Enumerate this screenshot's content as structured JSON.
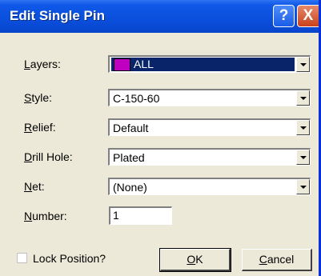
{
  "window": {
    "title": "Edit Single Pin",
    "help_glyph": "?",
    "close_glyph": "X"
  },
  "fields": {
    "layers": {
      "label_ul": "L",
      "label_rest": "ayers:",
      "value": "ALL",
      "swatch_color": "#c000c0"
    },
    "style": {
      "label_ul": "S",
      "label_rest": "tyle:",
      "value": "C-150-60"
    },
    "relief": {
      "label_ul": "R",
      "label_rest": "elief:",
      "value": "Default"
    },
    "drill_hole": {
      "label_ul": "D",
      "label_rest": "rill Hole:",
      "value": "Plated"
    },
    "net": {
      "label_ul": "N",
      "label_rest": "et:",
      "value": "(None)"
    },
    "number": {
      "label_ul": "N",
      "label_rest": "umber:",
      "value": "1"
    }
  },
  "lock_position": {
    "label": "Lock Position?",
    "checked": false
  },
  "buttons": {
    "ok": {
      "ul": "O",
      "rest": "K"
    },
    "cancel": {
      "ul": "C",
      "rest": "ancel"
    }
  }
}
